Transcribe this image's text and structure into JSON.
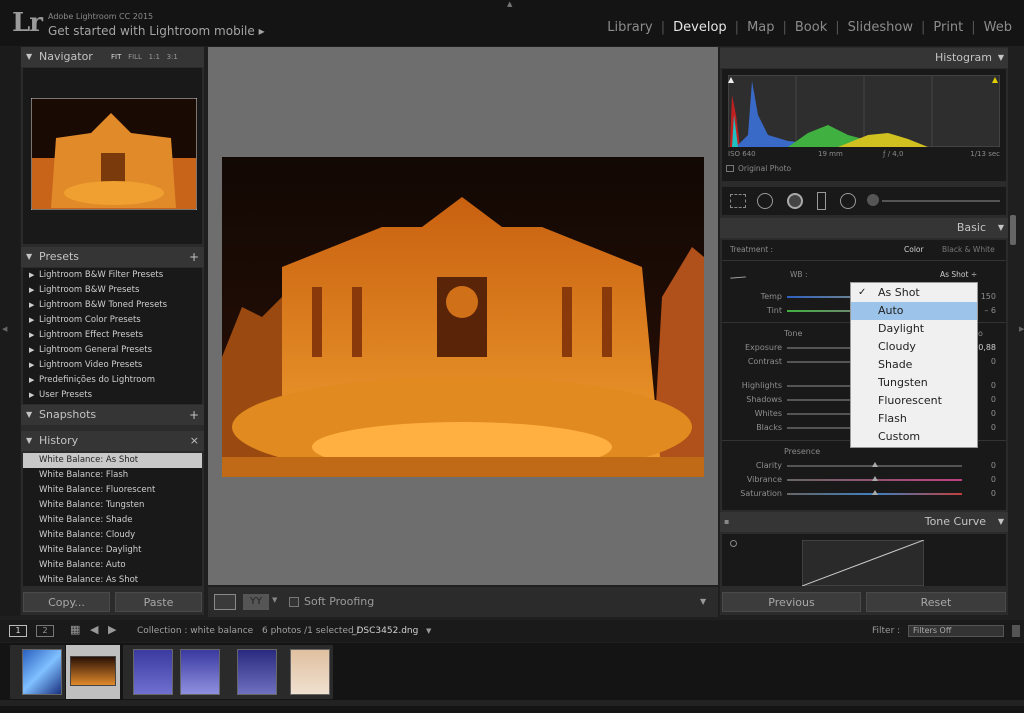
{
  "app": {
    "title": "Adobe Lightroom CC 2015",
    "subtitle": "Get started with Lightroom mobile",
    "logo": "Lr",
    "subtitle_arrow": "▸"
  },
  "modules": [
    "Library",
    "Develop",
    "Map",
    "Book",
    "Slideshow",
    "Print",
    "Web"
  ],
  "active_module": "Develop",
  "navigator": {
    "title": "Navigator",
    "zoom": [
      "FIT",
      "FILL",
      "1:1",
      "3:1"
    ]
  },
  "presets": {
    "title": "Presets",
    "items": [
      "Lightroom B&W Filter Presets",
      "Lightroom B&W Presets",
      "Lightroom B&W Toned Presets",
      "Lightroom Color Presets",
      "Lightroom Effect Presets",
      "Lightroom General Presets",
      "Lightroom Video Presets",
      "Predefinições do Lightroom",
      "User Presets"
    ]
  },
  "snapshots": {
    "title": "Snapshots"
  },
  "history": {
    "title": "History",
    "items": [
      "White Balance: As Shot",
      "White Balance: Flash",
      "White Balance: Fluorescent",
      "White Balance: Tungsten",
      "White Balance: Shade",
      "White Balance: Cloudy",
      "White Balance: Daylight",
      "White Balance: Auto",
      "White Balance: As Shot"
    ]
  },
  "left_buttons": {
    "copy": "Copy...",
    "paste": "Paste"
  },
  "toolbar": {
    "soft_proofing": "Soft Proofing"
  },
  "histogram": {
    "title": "Histogram",
    "iso": "ISO 640",
    "focal": "19 mm",
    "aperture": "ƒ / 4,0",
    "shutter": "1/13 sec",
    "original": "Original Photo"
  },
  "basic": {
    "title": "Basic",
    "treatment_label": "Treatment :",
    "treatment_color": "Color",
    "treatment_bw": "Black & White",
    "wb_label": "WB :",
    "wb_value": "As Shot ÷",
    "temp_label": "Temp",
    "temp_val": "150",
    "tint_label": "Tint",
    "tint_val": "– 6",
    "tone_label": "Tone",
    "tone_auto": "o",
    "exposure_label": "Exposure",
    "exposure_val": "0,88",
    "contrast_label": "Contrast",
    "contrast_val": "0",
    "highlights_label": "Highlights",
    "highlights_val": "0",
    "shadows_label": "Shadows",
    "shadows_val": "0",
    "whites_label": "Whites",
    "whites_val": "0",
    "blacks_label": "Blacks",
    "blacks_val": "0",
    "presence_label": "Presence",
    "clarity_label": "Clarity",
    "clarity_val": "0",
    "vibrance_label": "Vibrance",
    "vibrance_val": "0",
    "saturation_label": "Saturation",
    "saturation_val": "0"
  },
  "wb_menu": {
    "items": [
      "As Shot",
      "Auto",
      "Daylight",
      "Cloudy",
      "Shade",
      "Tungsten",
      "Fluorescent",
      "Flash",
      "Custom"
    ],
    "checked": "As Shot",
    "highlighted": "Auto"
  },
  "tone_curve": {
    "title": "Tone Curve"
  },
  "right_buttons": {
    "previous": "Previous",
    "reset": "Reset"
  },
  "filmstrip": {
    "view1": "1",
    "view2": "2",
    "collection": "Collection : white balance",
    "count": "6 photos /1 selected /",
    "filename": "_DSC3452.dng",
    "filter_label": "Filter :",
    "filter_value": "Filters Off"
  }
}
